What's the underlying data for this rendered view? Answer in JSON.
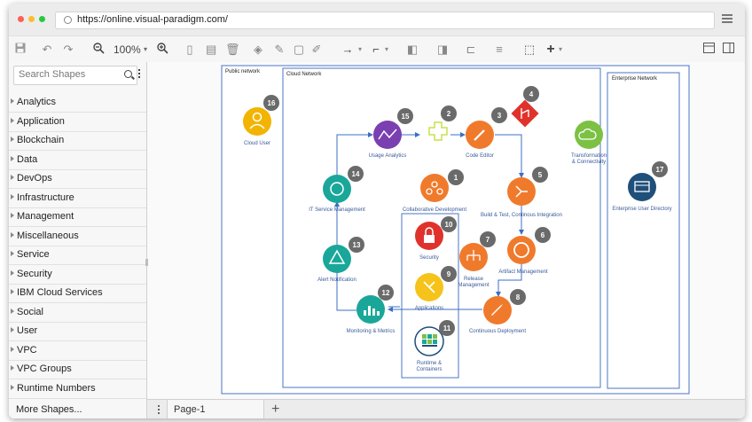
{
  "browser": {
    "url": "https://online.visual-paradigm.com/",
    "colors": {
      "close": "#ff5f57",
      "minimize": "#febc2e",
      "maximize": "#28c840"
    }
  },
  "toolbar": {
    "zoom": "100%",
    "icons": [
      "save-icon",
      "undo-icon",
      "redo-icon",
      "zoom-out-icon",
      "zoom-in-icon",
      "copy-icon",
      "paste-icon",
      "delete-icon",
      "fill-icon",
      "line-color-icon",
      "shadow-icon",
      "format-painter-icon",
      "connector-icon",
      "waypoint-icon",
      "to-front-icon",
      "to-back-icon",
      "align-icon",
      "distribute-icon",
      "select-icon",
      "insert-icon",
      "format-panel-icon",
      "outline-panel-icon"
    ]
  },
  "sidebar": {
    "search_placeholder": "Search Shapes",
    "categories": [
      "Analytics",
      "Application",
      "Blockchain",
      "Data",
      "DevOps",
      "Infrastructure",
      "Management",
      "Miscellaneous",
      "Service",
      "Security",
      "IBM Cloud Services",
      "Social",
      "User",
      "VPC",
      "VPC Groups",
      "Runtime Numbers"
    ],
    "more": "More Shapes..."
  },
  "pages": {
    "current": "Page-1"
  },
  "diagram": {
    "zones": {
      "public": "Public network",
      "cloud": "Cloud Network",
      "enterprise": "Enterprise Network"
    },
    "nodes": [
      {
        "num": "16",
        "label": "Cloud User"
      },
      {
        "num": "15",
        "label": "Usage Analytics"
      },
      {
        "num": "2",
        "label": ""
      },
      {
        "num": "3",
        "label": "Code Editor"
      },
      {
        "num": "4",
        "label": ""
      },
      {
        "num": "",
        "label": "Transformation & Connectivity"
      },
      {
        "num": "14",
        "label": "IT Service Management"
      },
      {
        "num": "1",
        "label": "Collaborative Development"
      },
      {
        "num": "5",
        "label": "Build & Test, Continous Integration"
      },
      {
        "num": "13",
        "label": "Alert Notification"
      },
      {
        "num": "10",
        "label": "Security"
      },
      {
        "num": "7",
        "label": "Release Management"
      },
      {
        "num": "6",
        "label": "Artifact Management"
      },
      {
        "num": "9",
        "label": "Applications"
      },
      {
        "num": "12",
        "label": "Monitoring & Metrics"
      },
      {
        "num": "8",
        "label": "Continuous Deployment"
      },
      {
        "num": "11",
        "label": "Runtime & Containers"
      },
      {
        "num": "17",
        "label": "Enterprise User Directory"
      }
    ],
    "node_colors": {
      "teal": "#1aa79a",
      "purple": "#7a3fb0",
      "orange": "#f07a2c",
      "red": "#e0322c",
      "green": "#7cc143",
      "yellow": "#f6c31b",
      "navy": "#1f4f7a",
      "gold": "#f2b400",
      "badge": "#6a6a6a"
    }
  }
}
